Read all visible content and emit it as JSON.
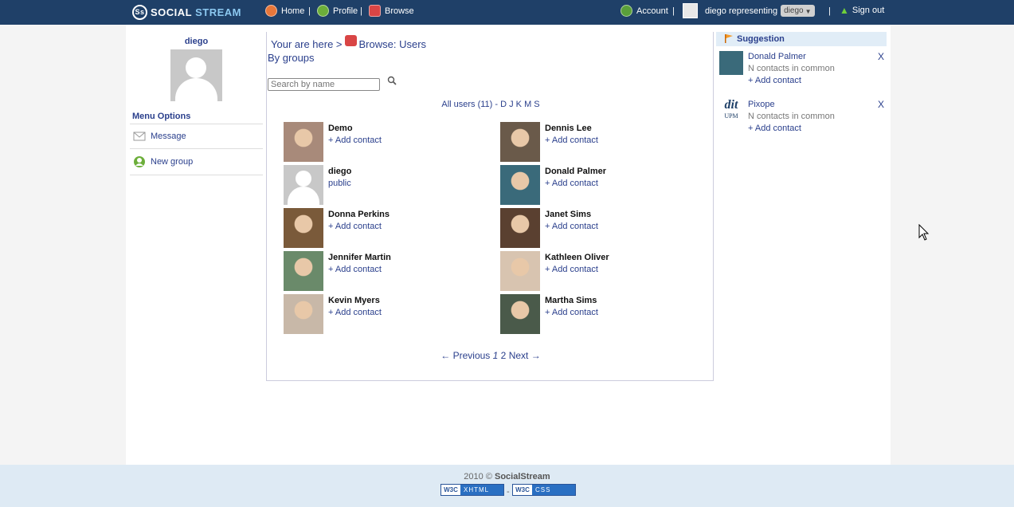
{
  "brand": {
    "left": "SOCIAL",
    "right": "STREAM",
    "badge": "Ss"
  },
  "nav": {
    "home": "Home",
    "profile": "Profile",
    "browse": "Browse",
    "sep": "|",
    "account": "Account",
    "representing": "diego representing",
    "identity": "diego",
    "signout": "Sign out"
  },
  "left": {
    "username": "diego",
    "menu_title": "Menu Options",
    "items": [
      {
        "label": "Message"
      },
      {
        "label": "New group"
      }
    ]
  },
  "center": {
    "breadcrumb_prefix": "Your are here >",
    "breadcrumb_current": "Browse: Users",
    "by_groups": "By groups",
    "search_placeholder": "Search by name",
    "filter": "All users (11) - D J K M S",
    "users": [
      {
        "name": "Demo",
        "action": "+ Add contact",
        "col": 0,
        "row": 0,
        "photo": "#a88a7a"
      },
      {
        "name": "Dennis Lee",
        "action": "+ Add contact",
        "col": 1,
        "row": 0,
        "photo": "#6a5a4a"
      },
      {
        "name": "diego",
        "action": "public",
        "col": 0,
        "row": 1,
        "photo": "default"
      },
      {
        "name": "Donald Palmer",
        "action": "+ Add contact",
        "col": 1,
        "row": 1,
        "photo": "#3a6a7a"
      },
      {
        "name": "Donna Perkins",
        "action": "+ Add contact",
        "col": 0,
        "row": 2,
        "photo": "#7a5a3a"
      },
      {
        "name": "Janet Sims",
        "action": "+ Add contact",
        "col": 1,
        "row": 2,
        "photo": "#5a4030"
      },
      {
        "name": "Jennifer Martin",
        "action": "+ Add contact",
        "col": 0,
        "row": 3,
        "photo": "#6a8a6a"
      },
      {
        "name": "Kathleen Oliver",
        "action": "+ Add contact",
        "col": 1,
        "row": 3,
        "photo": "#d8c4b0"
      },
      {
        "name": "Kevin Myers",
        "action": "+ Add contact",
        "col": 0,
        "row": 4,
        "photo": "#c8b8a8"
      },
      {
        "name": "Martha Sims",
        "action": "+ Add contact",
        "col": 1,
        "row": 4,
        "photo": "#4a5a4a"
      }
    ],
    "pager": {
      "prev": "← Previous",
      "current": "1",
      "next_page": "2",
      "next": "Next →"
    }
  },
  "suggestion": {
    "title": "Suggestion",
    "items": [
      {
        "name": "Donald Palmer",
        "sub": "N contacts in common",
        "add": "+ Add contact",
        "close": "X",
        "photo": "#3a6a7a"
      },
      {
        "name": "Pixope",
        "sub": "N contacts in common",
        "add": "+ Add contact",
        "close": "X",
        "photo": "logo",
        "logo_top": "dit",
        "logo_bottom": "UPM"
      }
    ]
  },
  "footer": {
    "year": "2010 ©",
    "brand": "SocialStream",
    "badge1": "XHTML",
    "badge2": "CSS",
    "w3c": "W3C",
    "dash": "-"
  },
  "colors": {
    "topbar": "#1f4068",
    "link": "#2a3f8c",
    "footer": "#deeaf4"
  }
}
